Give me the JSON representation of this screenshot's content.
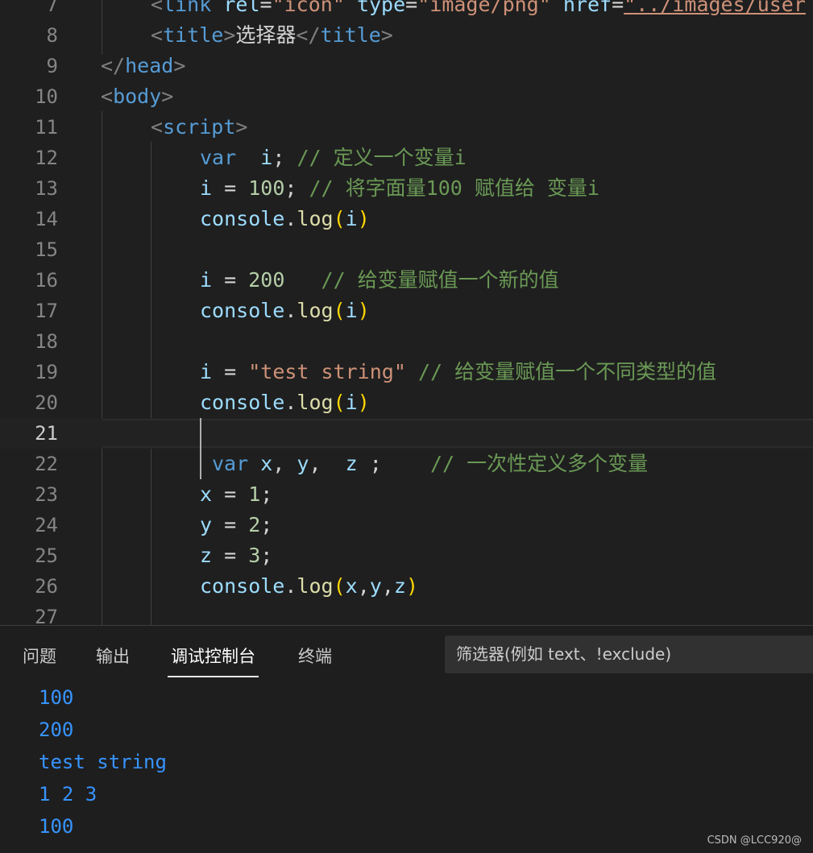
{
  "editor": {
    "lines": [
      {
        "n": "7",
        "indent": 187,
        "tokens": [
          [
            "t-punc",
            "<"
          ],
          [
            "t-tag",
            "link"
          ],
          [
            "t-txt",
            " "
          ],
          [
            "t-attr",
            "rel"
          ],
          [
            "t-txt",
            "="
          ],
          [
            "t-str",
            "\"icon\""
          ],
          [
            "t-txt",
            " "
          ],
          [
            "t-attr",
            "type"
          ],
          [
            "t-txt",
            "="
          ],
          [
            "t-str",
            "\"image/png\""
          ],
          [
            "t-txt",
            " "
          ],
          [
            "t-attr",
            "href"
          ],
          [
            "t-txt",
            "="
          ],
          [
            "t-link",
            "\"../images/user"
          ]
        ]
      },
      {
        "n": "8",
        "indent": 187,
        "tokens": [
          [
            "t-punc",
            "<"
          ],
          [
            "t-tag",
            "title"
          ],
          [
            "t-punc",
            ">"
          ],
          [
            "t-txt",
            "选择器"
          ],
          [
            "t-punc",
            "</"
          ],
          [
            "t-tag",
            "title"
          ],
          [
            "t-punc",
            ">"
          ]
        ]
      },
      {
        "n": "9",
        "indent": 125,
        "tokens": [
          [
            "t-punc",
            "</"
          ],
          [
            "t-tag",
            "head"
          ],
          [
            "t-punc",
            ">"
          ]
        ]
      },
      {
        "n": "10",
        "indent": 125,
        "tokens": [
          [
            "t-punc",
            "<"
          ],
          [
            "t-tag",
            "body"
          ],
          [
            "t-punc",
            ">"
          ]
        ]
      },
      {
        "n": "11",
        "indent": 187,
        "tokens": [
          [
            "t-punc",
            "<"
          ],
          [
            "t-tag",
            "script"
          ],
          [
            "t-punc",
            ">"
          ]
        ]
      },
      {
        "n": "12",
        "indent": 248,
        "tokens": [
          [
            "t-kw",
            "var"
          ],
          [
            "t-txt",
            "  "
          ],
          [
            "t-var",
            "i"
          ],
          [
            "t-txt",
            "; "
          ],
          [
            "t-com",
            "// 定义一个变量i"
          ]
        ]
      },
      {
        "n": "13",
        "indent": 248,
        "tokens": [
          [
            "t-var",
            "i"
          ],
          [
            "t-txt",
            " = "
          ],
          [
            "t-num",
            "100"
          ],
          [
            "t-txt",
            "; "
          ],
          [
            "t-com",
            "// 将字面量100 赋值给 变量i"
          ]
        ]
      },
      {
        "n": "14",
        "indent": 248,
        "tokens": [
          [
            "t-var",
            "console"
          ],
          [
            "t-txt",
            "."
          ],
          [
            "t-fn",
            "log"
          ],
          [
            "t-br",
            "("
          ],
          [
            "t-var",
            "i"
          ],
          [
            "t-br",
            ")"
          ]
        ]
      },
      {
        "n": "15",
        "indent": 248,
        "tokens": []
      },
      {
        "n": "16",
        "indent": 248,
        "tokens": [
          [
            "t-var",
            "i"
          ],
          [
            "t-txt",
            " = "
          ],
          [
            "t-num",
            "200"
          ],
          [
            "t-txt",
            "   "
          ],
          [
            "t-com",
            "// 给变量赋值一个新的值"
          ]
        ]
      },
      {
        "n": "17",
        "indent": 248,
        "tokens": [
          [
            "t-var",
            "console"
          ],
          [
            "t-txt",
            "."
          ],
          [
            "t-fn",
            "log"
          ],
          [
            "t-br",
            "("
          ],
          [
            "t-var",
            "i"
          ],
          [
            "t-br",
            ")"
          ]
        ]
      },
      {
        "n": "18",
        "indent": 248,
        "tokens": []
      },
      {
        "n": "19",
        "indent": 248,
        "tokens": [
          [
            "t-var",
            "i"
          ],
          [
            "t-txt",
            " = "
          ],
          [
            "t-str",
            "\"test string\""
          ],
          [
            "t-txt",
            " "
          ],
          [
            "t-com",
            "// 给变量赋值一个不同类型的值"
          ]
        ]
      },
      {
        "n": "20",
        "indent": 248,
        "tokens": [
          [
            "t-var",
            "console"
          ],
          [
            "t-txt",
            "."
          ],
          [
            "t-fn",
            "log"
          ],
          [
            "t-br",
            "("
          ],
          [
            "t-var",
            "i"
          ],
          [
            "t-br",
            ")"
          ]
        ]
      },
      {
        "n": "21",
        "indent": 248,
        "tokens": [],
        "active": true
      },
      {
        "n": "22",
        "indent": 263,
        "tokens": [
          [
            "t-kw",
            "var"
          ],
          [
            "t-txt",
            " "
          ],
          [
            "t-var",
            "x"
          ],
          [
            "t-txt",
            ", "
          ],
          [
            "t-var",
            "y"
          ],
          [
            "t-txt",
            ",  "
          ],
          [
            "t-var",
            "z"
          ],
          [
            "t-txt",
            " ;    "
          ],
          [
            "t-com",
            "// 一次性定义多个变量"
          ]
        ]
      },
      {
        "n": "23",
        "indent": 248,
        "tokens": [
          [
            "t-var",
            "x"
          ],
          [
            "t-txt",
            " = "
          ],
          [
            "t-num",
            "1"
          ],
          [
            "t-txt",
            ";"
          ]
        ]
      },
      {
        "n": "24",
        "indent": 248,
        "tokens": [
          [
            "t-var",
            "y"
          ],
          [
            "t-txt",
            " = "
          ],
          [
            "t-num",
            "2"
          ],
          [
            "t-txt",
            ";"
          ]
        ]
      },
      {
        "n": "25",
        "indent": 248,
        "tokens": [
          [
            "t-var",
            "z"
          ],
          [
            "t-txt",
            " = "
          ],
          [
            "t-num",
            "3"
          ],
          [
            "t-txt",
            ";"
          ]
        ]
      },
      {
        "n": "26",
        "indent": 248,
        "tokens": [
          [
            "t-var",
            "console"
          ],
          [
            "t-txt",
            "."
          ],
          [
            "t-fn",
            "log"
          ],
          [
            "t-br",
            "("
          ],
          [
            "t-var",
            "x"
          ],
          [
            "t-txt",
            ","
          ],
          [
            "t-var",
            "y"
          ],
          [
            "t-txt",
            ","
          ],
          [
            "t-var",
            "z"
          ],
          [
            "t-br",
            ")"
          ]
        ]
      },
      {
        "n": "27",
        "indent": 248,
        "tokens": []
      }
    ]
  },
  "panel": {
    "tabs": [
      {
        "label": "问题",
        "active": false
      },
      {
        "label": "输出",
        "active": false
      },
      {
        "label": "调试控制台",
        "active": true
      },
      {
        "label": "终端",
        "active": false
      }
    ],
    "filter_placeholder": "筛选器(例如 text、!exclude)",
    "output_lines": [
      "100",
      "200",
      "test string",
      "1 2 3",
      "100"
    ]
  },
  "watermark": "CSDN @LCC920@"
}
